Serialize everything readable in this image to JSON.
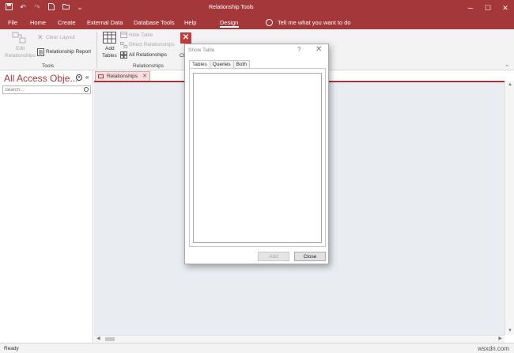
{
  "titlebar": {
    "context_title": "Relationship Tools",
    "qat_icons": [
      "save-icon",
      "undo-icon",
      "redo-icon",
      "new-icon",
      "open-icon",
      "customize-qat-icon"
    ]
  },
  "tabs": {
    "file": "File",
    "home": "Home",
    "create": "Create",
    "external_data": "External Data",
    "database_tools": "Database Tools",
    "help": "Help",
    "design": "Design",
    "tell_me": "Tell me what you want to do"
  },
  "ribbon": {
    "edit_relationships": "Edit\nRelationships",
    "edit_relationships_l1": "Edit",
    "edit_relationships_l2": "Relationships",
    "clear_layout": "Clear Layout",
    "relationship_report": "Relationship Report",
    "tools_group": "Tools",
    "add_tables_l1": "Add",
    "add_tables_l2": "Tables",
    "hide_table": "Hide Table",
    "direct_relationships": "Direct Relationships",
    "all_relationships": "All Relationships",
    "close_short": "Cl",
    "relationships_group": "Relationships"
  },
  "nav": {
    "title": "All Access Obje...",
    "collapse": "«",
    "search_placeholder": "Search..."
  },
  "document": {
    "tab_label": "Relationships"
  },
  "dialog": {
    "title": "Show Table",
    "help": "?",
    "tabs": [
      "Tables",
      "Queries",
      "Both"
    ],
    "active_tab": "Tables",
    "add_button": "Add",
    "close_button": "Close"
  },
  "status": {
    "text": "Ready",
    "watermark": "wsxdn.com"
  },
  "colors": {
    "accent": "#a4373a",
    "workspace": "#e9ecf0"
  }
}
